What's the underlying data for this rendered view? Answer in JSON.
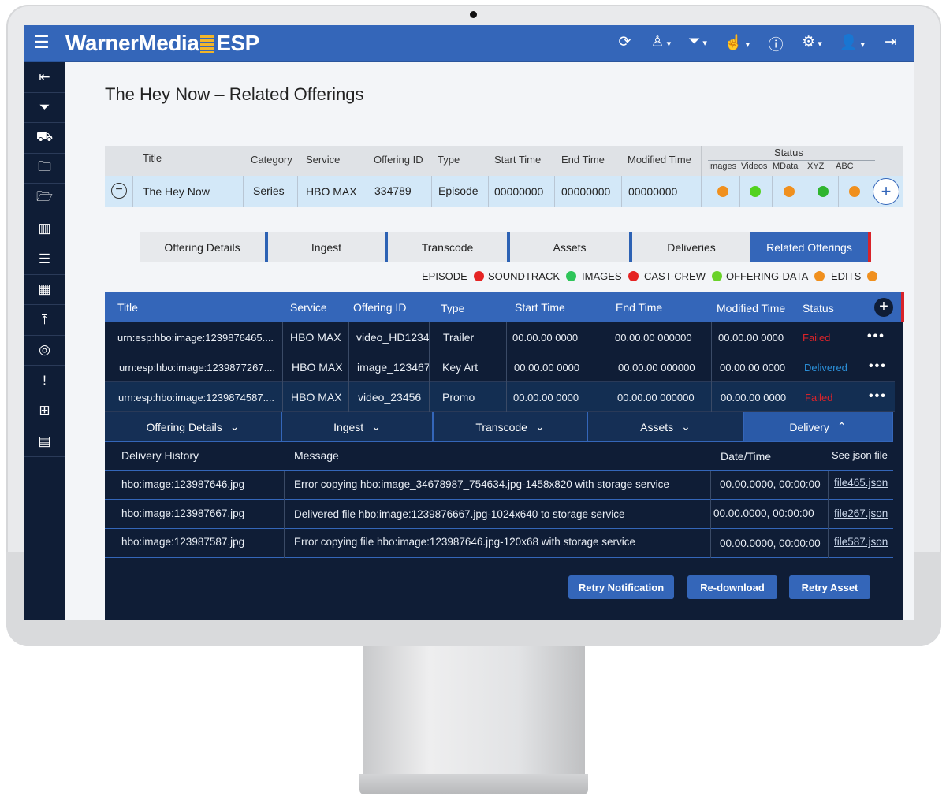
{
  "app": {
    "brand_left": "WarnerMedia",
    "brand_right": "ESP"
  },
  "topbar": {
    "icons": [
      "refresh-icon",
      "user-tree-icon",
      "filter-add-icon",
      "touch-icon",
      "info-icon",
      "gear-icon",
      "user-icon",
      "logout-icon"
    ]
  },
  "sidebar": {
    "icons": [
      "collapse-icon",
      "filter-icon",
      "delivery-truck-icon",
      "folder-info-icon",
      "folder-n-icon",
      "book-icon",
      "checklist-icon",
      "calendar-icon",
      "upload-icon",
      "hearing-icon",
      "alert-doc-icon",
      "grid-user-icon",
      "id-card-icon"
    ]
  },
  "page": {
    "title": "The Hey Now – Related Offerings"
  },
  "summary": {
    "headers": {
      "title": "Title",
      "category": "Category",
      "service": "Service",
      "offering_id": "Offering ID",
      "type": "Type",
      "start_time": "Start Time",
      "end_time": "End Time",
      "modified_time": "Modified Time",
      "status": "Status"
    },
    "status_cols": [
      "Images",
      "Videos",
      "MData",
      "XYZ",
      "ABC"
    ],
    "row": {
      "title": "The Hey Now",
      "category": "Series",
      "service": "HBO MAX",
      "offering_id": "334789",
      "type": "Episode",
      "start_time": "00000000",
      "end_time": "00000000",
      "modified_time": "00000000"
    },
    "status_colors": [
      "#f0901e",
      "#52d21e",
      "#f0901e",
      "#2fb52f",
      "#f0901e"
    ]
  },
  "tabs": [
    "Offering Details",
    "Ingest",
    "Transcode",
    "Assets",
    "Deliveries",
    "Related Offerings"
  ],
  "legend": [
    {
      "label": "EPISODE",
      "color": "#e52424"
    },
    {
      "label": "SOUNDTRACK",
      "color": "#2fc55a"
    },
    {
      "label": "IMAGES",
      "color": "#e52424"
    },
    {
      "label": "CAST-CREW",
      "color": "#6ad22a"
    },
    {
      "label": "OFFERING-DATA",
      "color": "#f0901e"
    },
    {
      "label": "EDITS",
      "color": "#f0901e"
    }
  ],
  "related": {
    "headers": {
      "title": "Title",
      "service": "Service",
      "offering_id": "Offering ID",
      "type": "Type",
      "start_time": "Start Time",
      "end_time": "End Time",
      "modified_time": "Modified Time",
      "status": "Status"
    },
    "rows": [
      {
        "title": "urn:esp:hbo:image:1239876465....",
        "service": "HBO MAX",
        "offering_id": "video_HD1234",
        "type": "Trailer",
        "start_time": "00.00.00 0000",
        "end_time": "00.00.00 000000",
        "modified_time": "00.00.00 0000",
        "status": "Failed"
      },
      {
        "title": "urn:esp:hbo:image:1239877267....",
        "service": "HBO MAX",
        "offering_id": "image_123467",
        "type": "Key Art",
        "start_time": "00.00.00 0000",
        "end_time": "00.00.00 000000",
        "modified_time": "00.00.00 0000",
        "status": "Delivered"
      },
      {
        "title": "urn:esp:hbo:image:1239874587....",
        "service": "HBO MAX",
        "offering_id": "video_23456",
        "type": "Promo",
        "start_time": "00.00.00 0000",
        "end_time": "00.00.00 000000",
        "modified_time": "00.00.00 0000",
        "status": "Failed"
      }
    ],
    "more": "•••"
  },
  "subtabs": [
    "Offering Details",
    "Ingest",
    "Transcode",
    "Assets",
    "Delivery"
  ],
  "history": {
    "headers": {
      "delivery_history": "Delivery History",
      "message": "Message",
      "datetime": "Date/Time",
      "json": "See json file"
    },
    "rows": [
      {
        "file": "hbo:image:123987646.jpg",
        "message": "Error copying hbo:image_34678987_754634.jpg-1458x820 with storage service",
        "datetime": "00.00.0000, 00:00:00",
        "json": "file465.json"
      },
      {
        "file": "hbo:image:123987667.jpg",
        "message": "Delivered file hbo:image:1239876667.jpg-1024x640 to storage service",
        "datetime": "00.00.0000, 00:00:00",
        "json": "file267.json"
      },
      {
        "file": "hbo:image:123987587.jpg",
        "message": "Error copying file hbo:image:123987646.jpg-120x68 with storage service",
        "datetime": "00.00.0000, 00:00:00",
        "json": "file587.json"
      }
    ]
  },
  "buttons": {
    "retry_notification": "Retry Notification",
    "redownload": "Re-download",
    "retry_asset": "Retry Asset"
  }
}
